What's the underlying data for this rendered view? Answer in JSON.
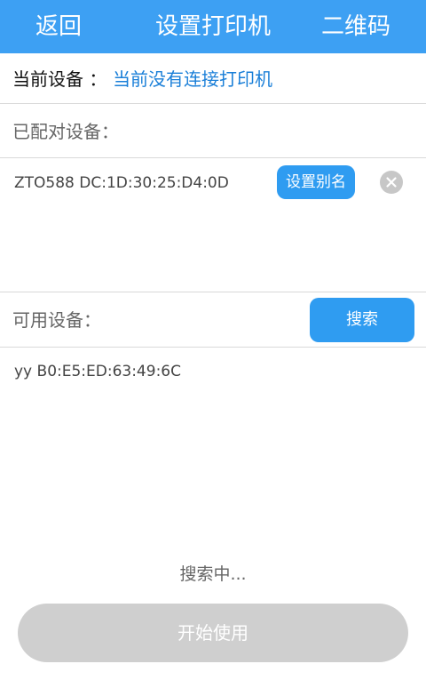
{
  "header": {
    "back_label": "返回",
    "title": "设置打印机",
    "qr_label": "二维码",
    "background_color": "#3da0f3"
  },
  "current_device": {
    "label": "当前设备 ：",
    "value": "当前没有连接打印机",
    "value_color": "#1a7fd8"
  },
  "paired": {
    "label": "已配对设备：",
    "items": [
      {
        "name": "ZTO588 DC:1D:30:25:D4:0D",
        "alias_button_label": "设置别名",
        "remove_icon": "close-circle-icon"
      }
    ]
  },
  "available": {
    "label": "可用设备：",
    "search_button_label": "搜索",
    "items": [
      {
        "name": "yy B0:E5:ED:63:49:6C"
      }
    ]
  },
  "status": {
    "searching_text": "搜索中..."
  },
  "footer": {
    "start_button_label": "开始使用",
    "start_button_state": "disabled"
  },
  "colors": {
    "accent": "#2f9cf1",
    "divider": "#d9d9d9",
    "disabled_button": "#cfcfcf"
  }
}
